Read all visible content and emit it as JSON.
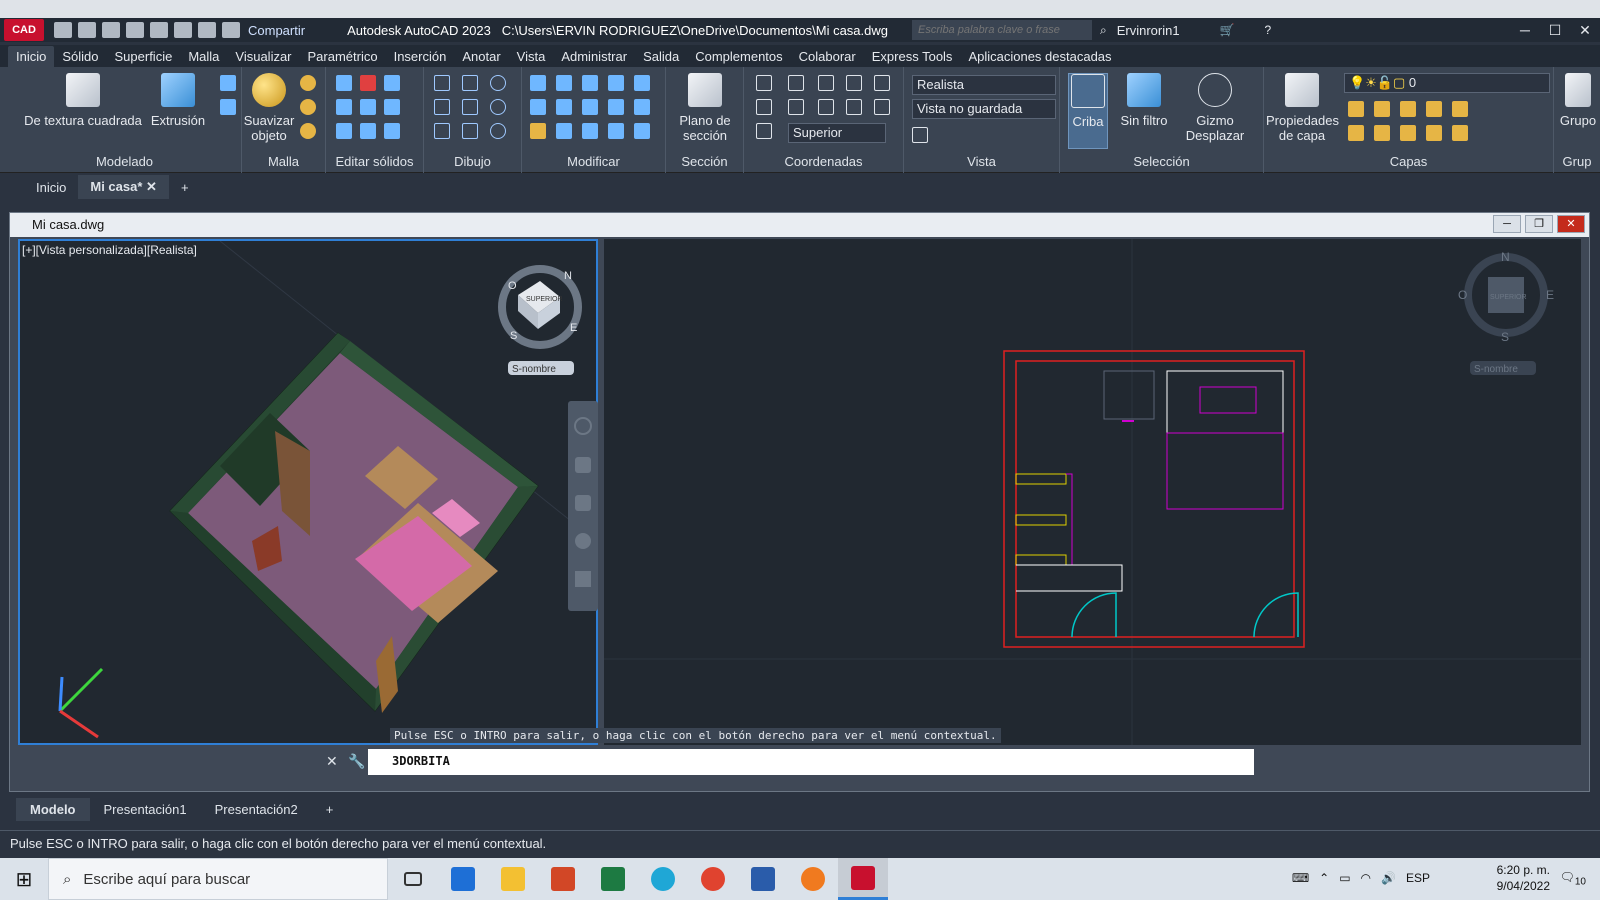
{
  "app": {
    "logo": "CAD",
    "share": "Compartir",
    "title": "Autodesk AutoCAD 2023",
    "path": "C:\\Users\\ERVIN RODRIGUEZ\\OneDrive\\Documentos\\Mi casa.dwg",
    "search_placeholder": "Escriba palabra clave o frase",
    "user": "Ervinrorin1"
  },
  "menu": [
    "Inicio",
    "Sólido",
    "Superficie",
    "Malla",
    "Visualizar",
    "Paramétrico",
    "Inserción",
    "Anotar",
    "Vista",
    "Administrar",
    "Salida",
    "Complementos",
    "Colaborar",
    "Express Tools",
    "Aplicaciones destacadas"
  ],
  "ribbon": {
    "panels": [
      "Modelado",
      "Malla",
      "Editar sólidos",
      "Dibujo",
      "Modificar",
      "Sección",
      "Coordenadas",
      "Vista",
      "Selección",
      "Capas",
      "Grup"
    ],
    "buttons": {
      "textura": "De textura cuadrada",
      "extrusion": "Extrusión",
      "suavizar": "Suavizar objeto",
      "plano": "Plano de sección",
      "criba": "Criba",
      "sinfiltro": "Sin filtro",
      "gizmo": "Gizmo Desplazar",
      "propiedades": "Propiedades de capa",
      "grupo": "Grupo"
    },
    "combos": {
      "visual": "Realista",
      "view": "Vista no guardada",
      "ucs": "Superior",
      "layer": "0"
    }
  },
  "filetabs": [
    "Inicio",
    "Mi casa*"
  ],
  "doc": {
    "title": "Mi casa.dwg",
    "viewport_label": "[+][Vista personalizada][Realista]",
    "viewcube_face": "SUPERIOR",
    "unnamed": "S-nombre",
    "compass": {
      "n": "N",
      "s": "S",
      "e": "E",
      "w": "O"
    }
  },
  "command": {
    "message": "Pulse ESC o INTRO para salir, o haga clic con el botón derecho para ver el menú contextual.",
    "input": "3DORBITA"
  },
  "layouts": [
    "Modelo",
    "Presentación1",
    "Presentación2"
  ],
  "status": "Pulse ESC o INTRO para salir, o haga clic con el botón derecho para ver el menú contextual.",
  "taskbar": {
    "search": "Escribe aquí para buscar",
    "lang": "ESP",
    "time": "6:20 p. m.",
    "date": "9/04/2022",
    "notifications": "10"
  },
  "colors": {
    "accent": "#2f7fd6",
    "wall": "#e02020",
    "furniture": "#d000d0",
    "door": "#00c8c8",
    "drawer": "#e0d000"
  }
}
